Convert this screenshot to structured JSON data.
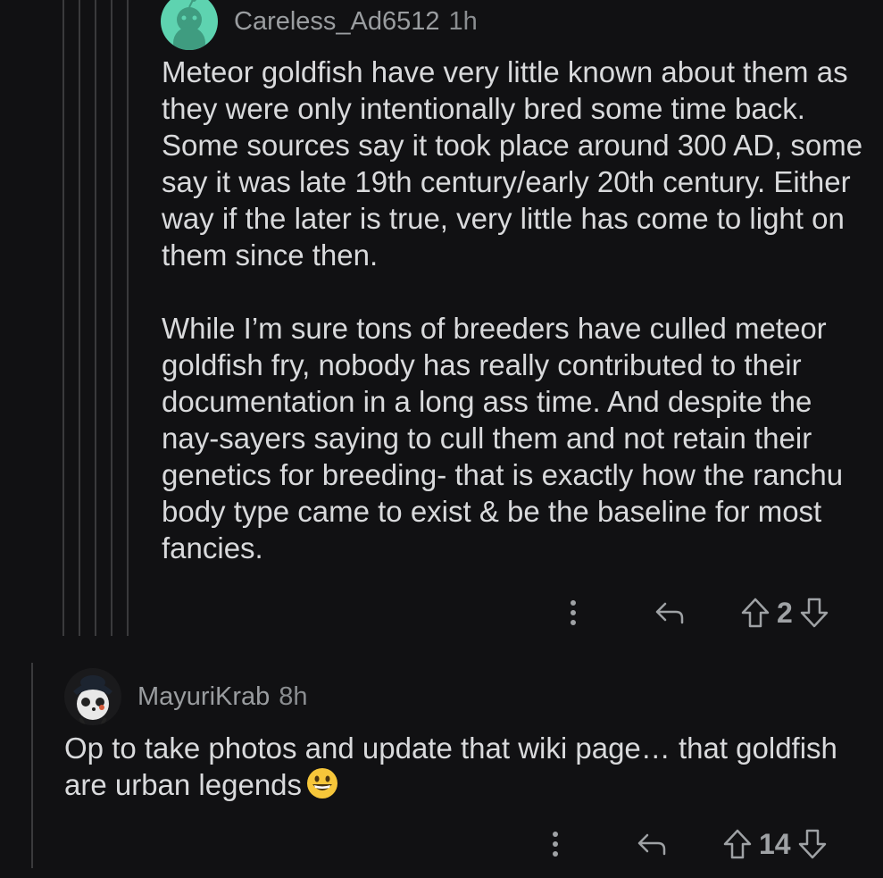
{
  "colors": {
    "background": "#111113",
    "text": "#d9dadc",
    "meta": "#9a9da0",
    "avatar_mint": "#5ed3b0"
  },
  "comments": [
    {
      "username": "Careless_Ad6512",
      "time": "1h",
      "avatar_icon": "snoo-avatar-icon",
      "paragraphs": [
        "Meteor goldfish have very little known about them as they were only intentionally bred some time back. Some sources say it took place around 300 AD, some say it was late 19th century/early 20th century. Either way if the later is true, very little has come to light on them since then.",
        "While I’m sure tons of breeders have culled meteor goldfish fry, nobody has really contributed to their documentation in a long ass time. And despite the nay-sayers saying to cull them and not retain their genetics for breeding- that is exactly how the ranchu body type came to exist & be the baseline for most fancies."
      ],
      "score": "2"
    },
    {
      "username": "MayuriKrab",
      "time": "8h",
      "avatar_icon": "panda-avatar-icon",
      "text": "Op to take photos and update that wiki page… that goldfish are urban legends",
      "emoji_icon": "grinning-face-emoji-icon",
      "score": "14"
    }
  ]
}
